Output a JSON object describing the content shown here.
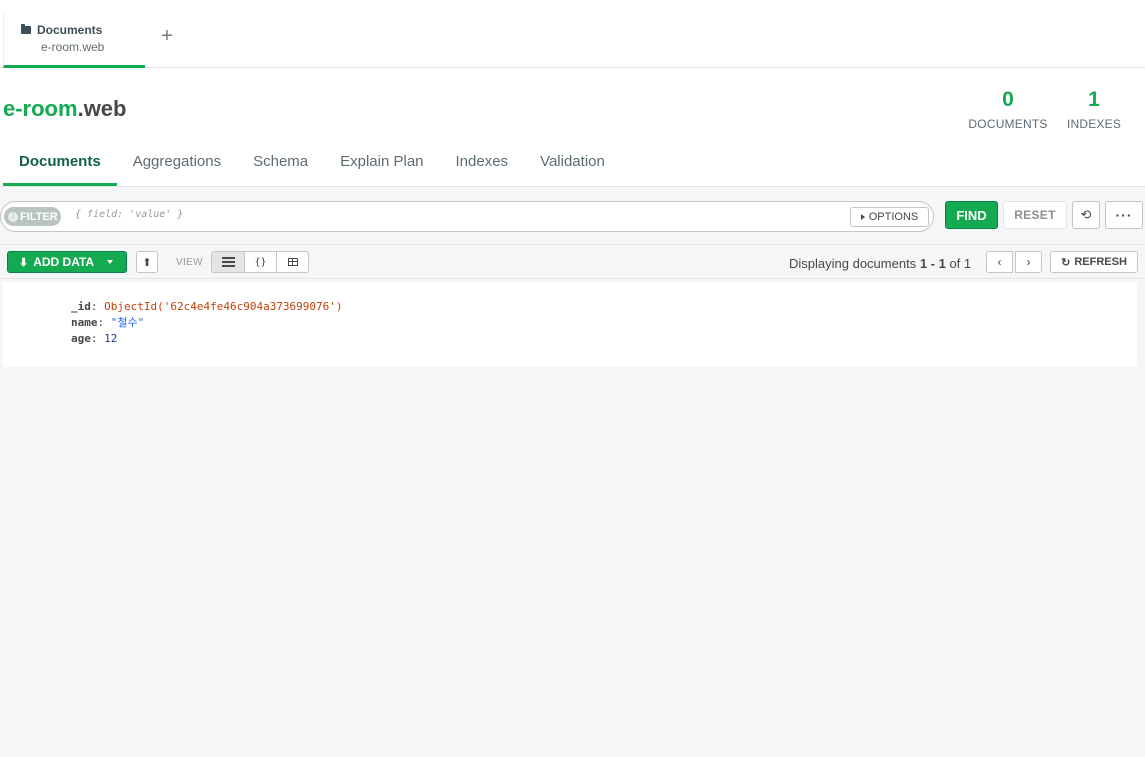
{
  "workspace_tab": {
    "title": "Documents",
    "subtitle": "e-room.web",
    "add_icon": "plus-icon"
  },
  "collection": {
    "db": "e-room",
    "separator": ".",
    "name": "web"
  },
  "stats": {
    "documents": {
      "value": "0",
      "label": "DOCUMENTS"
    },
    "indexes": {
      "value": "1",
      "label": "INDEXES"
    }
  },
  "subtabs": [
    {
      "label": "Documents",
      "active": true
    },
    {
      "label": "Aggregations"
    },
    {
      "label": "Schema"
    },
    {
      "label": "Explain Plan"
    },
    {
      "label": "Indexes"
    },
    {
      "label": "Validation"
    }
  ],
  "filter": {
    "pill_label": "FILTER",
    "placeholder": "{ field: 'value' }",
    "options_label": "OPTIONS"
  },
  "buttons": {
    "find": "FIND",
    "reset": "RESET",
    "history_icon": "history-icon",
    "more": "···"
  },
  "toolbar": {
    "add_data": "ADD DATA",
    "view_label": "VIEW",
    "view_list": "list-view",
    "view_json": "{}",
    "view_table": "table-view",
    "paging_prefix": "Displaying documents",
    "paging_range": "1 - 1",
    "paging_of": "of",
    "paging_total": "1",
    "refresh": "REFRESH"
  },
  "documents": [
    {
      "fields": [
        {
          "key": "_id",
          "value": "ObjectId('62c4e4fe46c904a373699076')"
        },
        {
          "key": "name",
          "value": "\"철수\""
        },
        {
          "key": "age",
          "value": "12"
        }
      ]
    }
  ],
  "colors": {
    "accent": "#13aa52",
    "accent_dark": "#13604b",
    "oid": "#c2410c",
    "string": "#2563eb"
  }
}
